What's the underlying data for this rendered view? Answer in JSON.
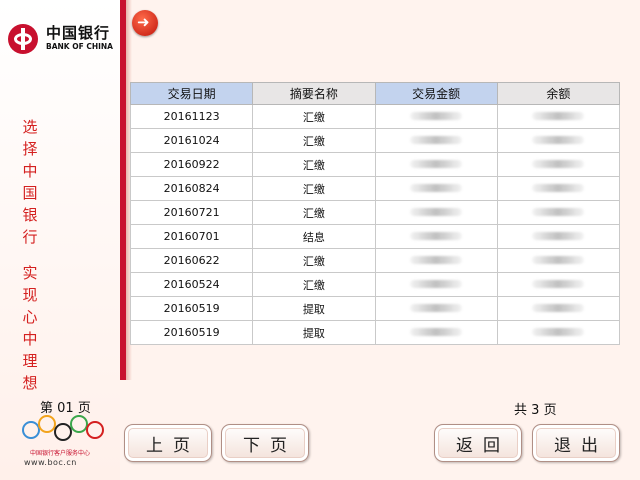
{
  "brand": {
    "name_cn": "中国银行",
    "name_en": "BANK OF CHINA",
    "hotline_label": "中国银行客户服务中心",
    "website": "www.boc.cn"
  },
  "slogan": {
    "line1": "选择中国银行",
    "line2": "实现心中理想"
  },
  "table": {
    "headers": [
      "交易日期",
      "摘要名称",
      "交易金额",
      "余额"
    ],
    "rows": [
      {
        "date": "20161123",
        "summary": "汇缴"
      },
      {
        "date": "20161024",
        "summary": "汇缴"
      },
      {
        "date": "20160922",
        "summary": "汇缴"
      },
      {
        "date": "20160824",
        "summary": "汇缴"
      },
      {
        "date": "20160721",
        "summary": "汇缴"
      },
      {
        "date": "20160701",
        "summary": "结息"
      },
      {
        "date": "20160622",
        "summary": "汇缴"
      },
      {
        "date": "20160524",
        "summary": "汇缴"
      },
      {
        "date": "20160519",
        "summary": "提取"
      },
      {
        "date": "20160519",
        "summary": "提取"
      }
    ]
  },
  "pagination": {
    "current_prefix": "第",
    "current": "01",
    "current_suffix": "页",
    "total_prefix": "共",
    "total": "3",
    "total_suffix": "页"
  },
  "buttons": {
    "prev": "上页",
    "next": "下页",
    "back": "返回",
    "exit": "退出"
  },
  "colors": {
    "brand_red": "#c8102e",
    "header_blue": "#c3d3ee",
    "header_gray": "#e8e6e6"
  }
}
